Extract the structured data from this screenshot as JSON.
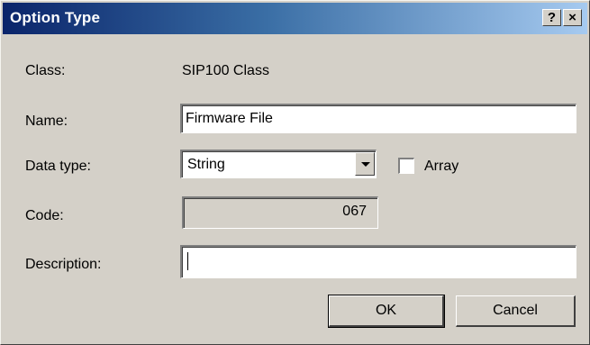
{
  "window": {
    "title": "Option Type",
    "help_label": "?",
    "close_label": "×"
  },
  "form": {
    "class_label": "Class:",
    "class_value": "SIP100 Class",
    "name_label": "Name:",
    "name_value": "Firmware File",
    "datatype_label": "Data type:",
    "datatype_value": "String",
    "array_label": "Array",
    "array_checked": false,
    "code_label": "Code:",
    "code_value": "067",
    "description_label": "Description:",
    "description_value": ""
  },
  "buttons": {
    "ok_label": "OK",
    "cancel_label": "Cancel"
  }
}
